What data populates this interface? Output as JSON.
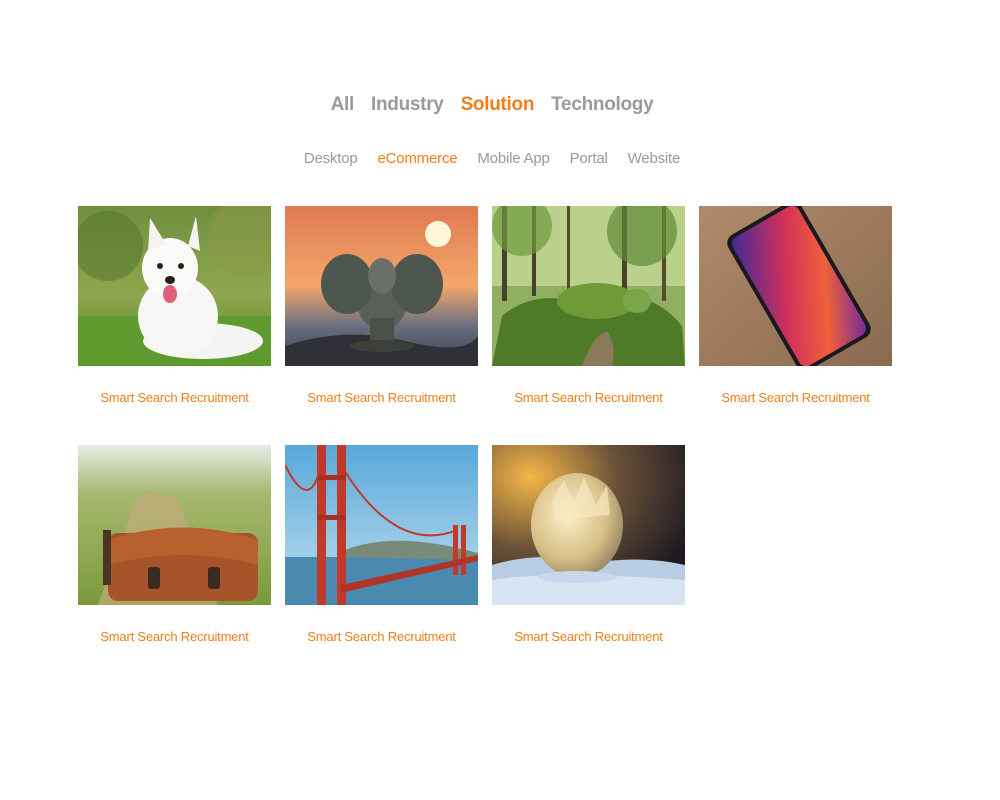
{
  "filters": {
    "primary": [
      {
        "label": "All",
        "active": false
      },
      {
        "label": "Industry",
        "active": false
      },
      {
        "label": "Solution",
        "active": true
      },
      {
        "label": "Technology",
        "active": false
      }
    ],
    "secondary": [
      {
        "label": "Desktop",
        "active": false
      },
      {
        "label": "eCommerce",
        "active": true
      },
      {
        "label": "Mobile App",
        "active": false
      },
      {
        "label": "Portal",
        "active": false
      },
      {
        "label": "Website",
        "active": false
      }
    ]
  },
  "portfolio": {
    "items": [
      {
        "title": "Smart Search Recruitment",
        "image": "white-dog"
      },
      {
        "title": "Smart Search Recruitment",
        "image": "elephant-statue-sunset"
      },
      {
        "title": "Smart Search Recruitment",
        "image": "mossy-sculpture-forest"
      },
      {
        "title": "Smart Search Recruitment",
        "image": "smartphone-on-wood"
      },
      {
        "title": "Smart Search Recruitment",
        "image": "leather-bag-field"
      },
      {
        "title": "Smart Search Recruitment",
        "image": "golden-gate-bridge"
      },
      {
        "title": "Smart Search Recruitment",
        "image": "frozen-bubble"
      }
    ]
  },
  "colors": {
    "accent": "#ef7f1a",
    "inactive": "#9a9a9a",
    "background": "#ffffff"
  }
}
